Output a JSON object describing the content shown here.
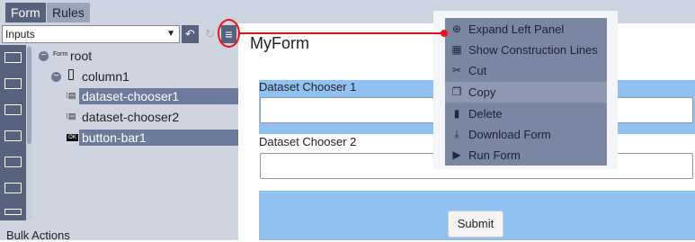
{
  "tabs": [
    {
      "label": "Form",
      "active": true
    },
    {
      "label": "Rules",
      "active": false
    }
  ],
  "toolbar": {
    "select_value": "Inputs",
    "undo_icon": "undo-icon",
    "redo_icon": "redo-icon",
    "menu_icon": "hamburger-icon"
  },
  "tree": [
    {
      "label": "root",
      "badge": "Form"
    },
    {
      "label": "column1"
    },
    {
      "label": "dataset-chooser1",
      "selected": true
    },
    {
      "label": "dataset-chooser2",
      "selected": false
    },
    {
      "label": "button-bar1",
      "selected": true,
      "badge": "OK"
    }
  ],
  "bulk_actions": "Bulk Actions",
  "form": {
    "title": "MyForm",
    "chooser1_label": "Dataset Chooser 1",
    "chooser2_label": "Dataset Chooser 2",
    "submit_label": "Submit"
  },
  "menu": [
    {
      "label": "Expand Left Panel",
      "icon": "plus-circle-icon"
    },
    {
      "label": "Show Construction Lines",
      "icon": "grid-icon"
    },
    {
      "label": "Cut",
      "icon": "scissors-icon"
    },
    {
      "label": "Copy",
      "icon": "copy-icon",
      "active": true
    },
    {
      "label": "Delete",
      "icon": "trash-icon"
    },
    {
      "label": "Download Form",
      "icon": "download-icon"
    },
    {
      "label": "Run Form",
      "icon": "play-icon"
    }
  ],
  "colors": {
    "accent": "#56627e",
    "highlight_block": "#91c1f1",
    "annotation": "#ee1111"
  }
}
